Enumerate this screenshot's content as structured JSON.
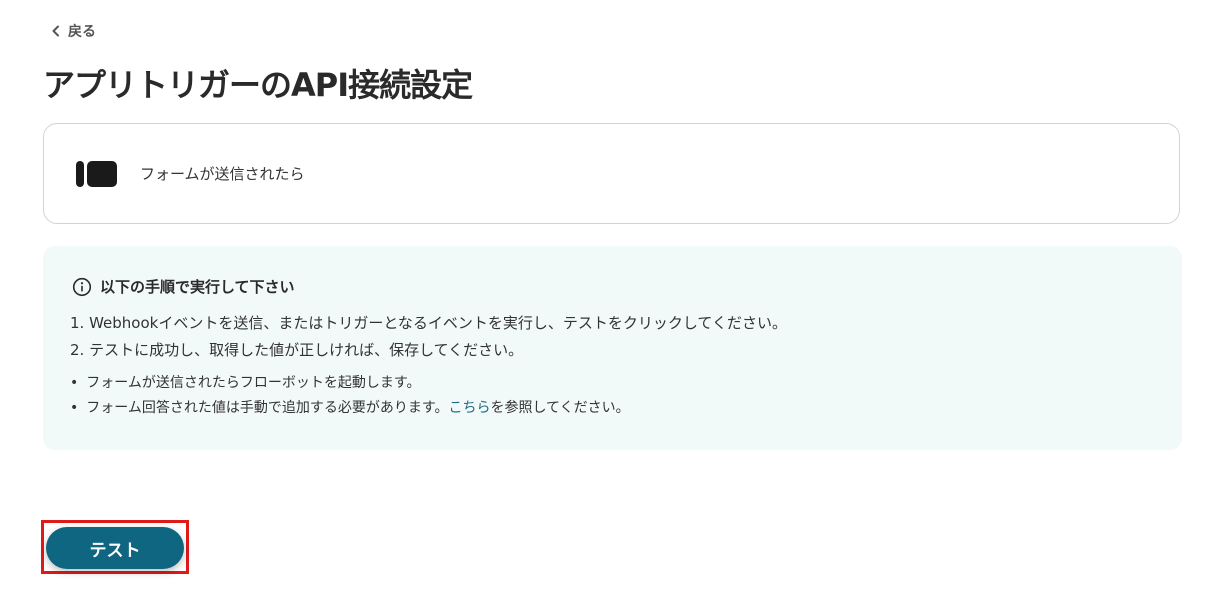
{
  "nav": {
    "back_label": "戻る"
  },
  "page": {
    "title": "アプリトリガーのAPI接続設定"
  },
  "app": {
    "trigger_label": "フォームが送信されたら"
  },
  "instructions": {
    "heading": "以下の手順で実行して下さい",
    "steps": [
      "1. Webhookイベントを送信、またはトリガーとなるイベントを実行し、テストをクリックしてください。",
      "2. テストに成功し、取得した値が正しければ、保存してください。"
    ],
    "notes": {
      "note1": "フォームが送信されたらフローボットを起動します。",
      "note2_before": "フォーム回答された値は手動で追加する必要があります。",
      "note2_link": "こちら",
      "note2_after": "を参照してください。"
    }
  },
  "actions": {
    "test_label": "テスト"
  },
  "colors": {
    "primary": "#0f6680",
    "link": "#1f6b86",
    "info_bg": "#f2f9f9",
    "highlight": "#e01919"
  }
}
